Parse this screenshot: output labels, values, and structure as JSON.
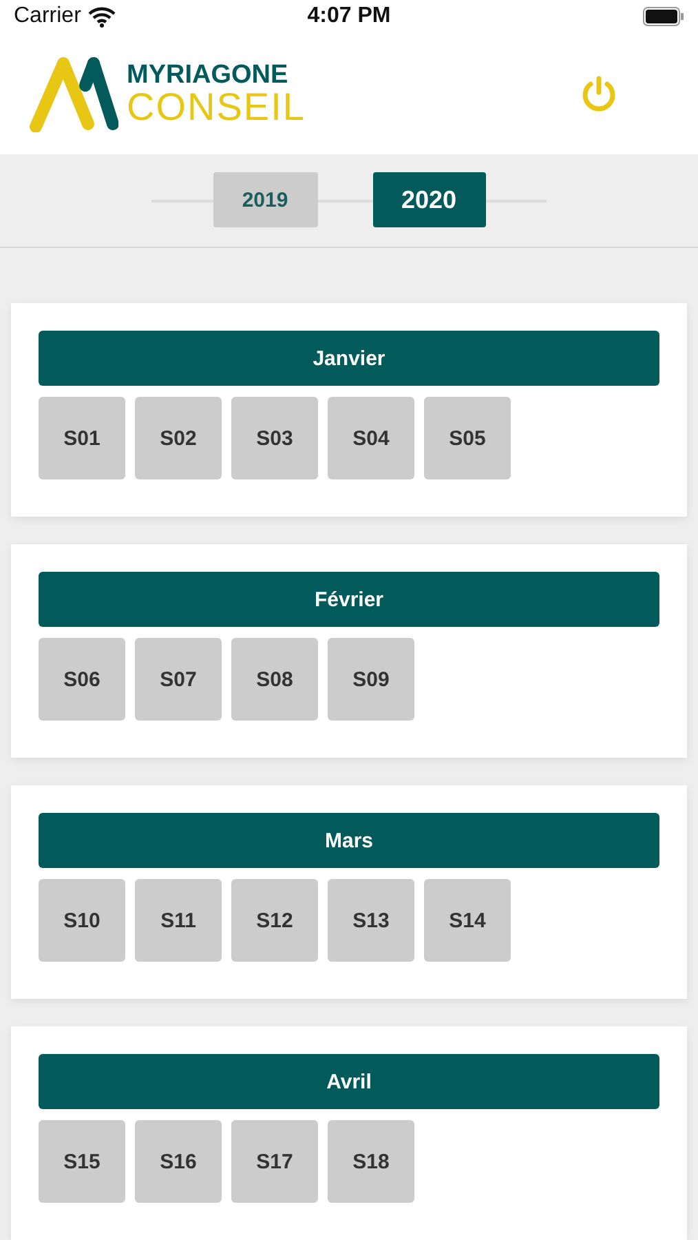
{
  "status_bar": {
    "carrier": "Carrier",
    "time": "4:07 PM"
  },
  "logo": {
    "line_1": "MYRIAGONE",
    "line_2": "CONSEIL"
  },
  "years": [
    {
      "label": "2019",
      "selected": false
    },
    {
      "label": "2020",
      "selected": true
    }
  ],
  "months": [
    {
      "name": "Janvier",
      "weeks": [
        "S01",
        "S02",
        "S03",
        "S04",
        "S05"
      ]
    },
    {
      "name": "Février",
      "weeks": [
        "S06",
        "S07",
        "S08",
        "S09"
      ]
    },
    {
      "name": "Mars",
      "weeks": [
        "S10",
        "S11",
        "S12",
        "S13",
        "S14"
      ]
    },
    {
      "name": "Avril",
      "weeks": [
        "S15",
        "S16",
        "S17",
        "S18"
      ]
    }
  ]
}
